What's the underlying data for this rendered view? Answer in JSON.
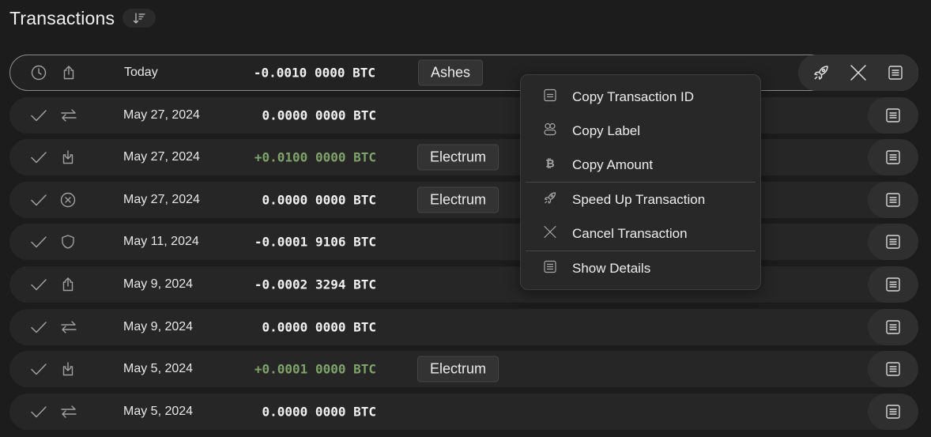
{
  "header": {
    "title": "Transactions"
  },
  "icons": {
    "sort": "sort-descending-icon",
    "pending": "clock-icon",
    "confirmed": "check-icon",
    "send": "upload-icon",
    "receive": "download-icon",
    "transfer": "arrows-swap-icon",
    "cancelled": "circle-x-icon",
    "shield": "shield-icon",
    "details": "list-details-icon",
    "speed": "rocket-icon",
    "cancel": "x-icon"
  },
  "colors": {
    "positive": "#7fa36a",
    "background": "#1c1c1c",
    "row": "#262626"
  },
  "transactions": [
    {
      "status": "pending",
      "type": "send",
      "date": "Today",
      "amount": "-0.0010 0000 BTC",
      "positive": false,
      "label": "Ashes",
      "selected": true
    },
    {
      "status": "confirmed",
      "type": "transfer",
      "date": "May 27, 2024",
      "amount": "0.0000 0000 BTC",
      "positive": false,
      "label": ""
    },
    {
      "status": "confirmed",
      "type": "receive",
      "date": "May 27, 2024",
      "amount": "+0.0100 0000 BTC",
      "positive": true,
      "label": "Electrum"
    },
    {
      "status": "confirmed",
      "type": "cancelled",
      "date": "May 27, 2024",
      "amount": "0.0000 0000 BTC",
      "positive": false,
      "label": "Electrum"
    },
    {
      "status": "confirmed",
      "type": "shield",
      "date": "May 11, 2024",
      "amount": "-0.0001 9106 BTC",
      "positive": false,
      "label": ""
    },
    {
      "status": "confirmed",
      "type": "send",
      "date": "May 9, 2024",
      "amount": "-0.0002 3294 BTC",
      "positive": false,
      "label": ""
    },
    {
      "status": "confirmed",
      "type": "transfer",
      "date": "May 9, 2024",
      "amount": "0.0000 0000 BTC",
      "positive": false,
      "label": ""
    },
    {
      "status": "confirmed",
      "type": "receive",
      "date": "May 5, 2024",
      "amount": "+0.0001 0000 BTC",
      "positive": true,
      "label": "Electrum"
    },
    {
      "status": "confirmed",
      "type": "transfer",
      "date": "May 5, 2024",
      "amount": "0.0000 0000 BTC",
      "positive": false,
      "label": ""
    }
  ],
  "context_menu": {
    "items": [
      {
        "label": "Copy Transaction ID",
        "icon": "card-icon"
      },
      {
        "label": "Copy Label",
        "icon": "tags-icon"
      },
      {
        "label": "Copy Amount",
        "icon": "bitcoin-icon"
      },
      {
        "label": "Speed Up Transaction",
        "icon": "rocket-icon"
      },
      {
        "label": "Cancel Transaction",
        "icon": "x-icon"
      },
      {
        "label": "Show Details",
        "icon": "list-details-icon"
      }
    ]
  }
}
